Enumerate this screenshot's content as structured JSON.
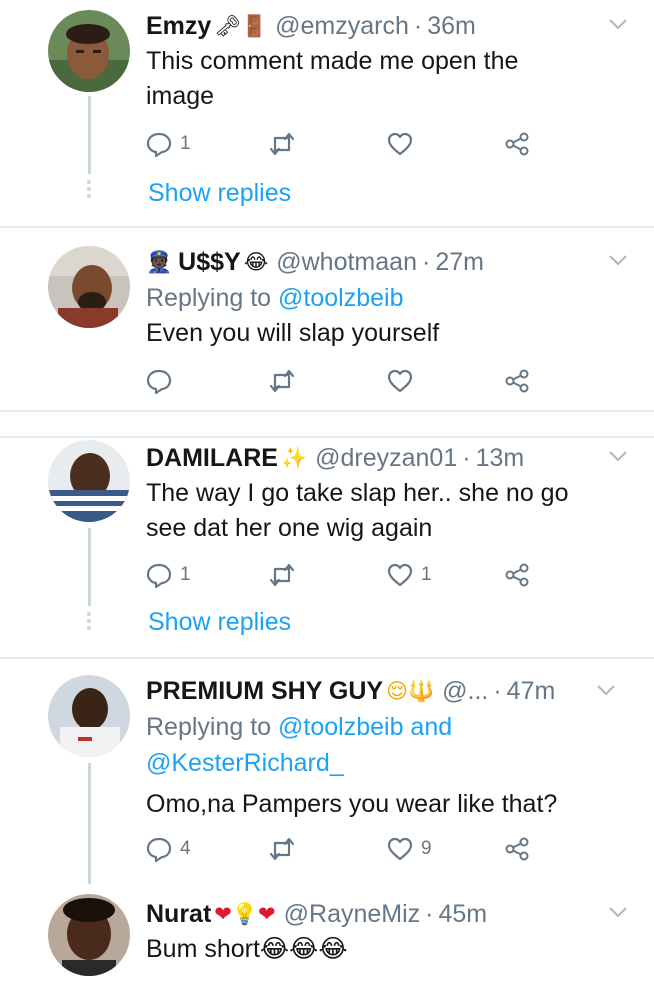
{
  "tweets": [
    {
      "name": "Emzy",
      "name_emojis": "🗝🚪",
      "handle": "@emzyarch",
      "time": "36m",
      "replying_label": "",
      "replying_to": "",
      "text_lines": [
        "This comment made me open the",
        "image"
      ],
      "replies": "1",
      "retweets": "",
      "likes": "",
      "show_replies": "Show replies"
    },
    {
      "name_prefix_emoji": "👮🏿",
      "name": "U$$Y",
      "name_emojis": "😂",
      "handle": "@whotmaan",
      "time": "27m",
      "replying_label": "Replying to",
      "replying_to": "@toolzbeib",
      "text_lines": [
        "Even you will slap yourself"
      ],
      "replies": "",
      "retweets": "",
      "likes": ""
    },
    {
      "name": "DAMILARE",
      "name_emojis": "✨",
      "handle": "@dreyzan01",
      "time": "13m",
      "text_lines": [
        "The way I go take slap her.. she no go",
        "see dat her one wig again"
      ],
      "replies": "1",
      "retweets": "",
      "likes": "1",
      "show_replies": "Show replies"
    },
    {
      "name": "PREMIUM SHY GUY",
      "name_emojis": "😌🔱",
      "handle": "@...",
      "time": "47m",
      "replying_label": "Replying to",
      "replying_to": "@toolzbeib and",
      "replying_to_2": "@KesterRichard_",
      "text_lines": [
        "Omo,na Pampers you wear like that?"
      ],
      "replies": "4",
      "retweets": "",
      "likes": "9"
    },
    {
      "name": "Nurat",
      "name_emojis": "❤💡❤",
      "handle": "@RayneMiz",
      "time": "45m",
      "text_lines": [
        "Bum short😂😂😂"
      ]
    }
  ],
  "colors": {
    "link": "#1da1f2",
    "secondary": "#657786",
    "divider": "#e6ecf0",
    "thread_line": "#ccd6dd"
  },
  "icons": [
    "reply-icon",
    "retweet-icon",
    "like-icon",
    "share-icon",
    "chevron-down-icon"
  ]
}
